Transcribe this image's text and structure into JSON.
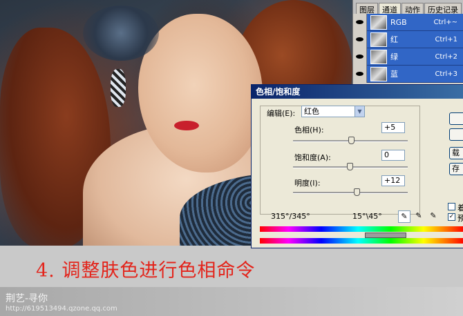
{
  "panel": {
    "tabs": [
      "图层",
      "通道",
      "动作",
      "历史记录"
    ],
    "active_tab": 1,
    "channels": [
      {
        "name": "RGB",
        "shortcut": "Ctrl+~"
      },
      {
        "name": "红",
        "shortcut": "Ctrl+1"
      },
      {
        "name": "绿",
        "shortcut": "Ctrl+2"
      },
      {
        "name": "蓝",
        "shortcut": "Ctrl+3"
      }
    ],
    "row_color": "#3166c6"
  },
  "dialog": {
    "title": "色相/饱和度",
    "edit_label": "编辑(E):",
    "edit_value": "红色",
    "hue_label": "色相(H):",
    "hue_value": "+5",
    "hue_level": 0.51,
    "saturation_label": "饱和度(A):",
    "saturation_value": "0",
    "saturation_level": 0.5,
    "lightness_label": "明度(I):",
    "lightness_value": "+12",
    "lightness_level": 0.56,
    "range_left": "315°/345°",
    "range_right": "15°\\45°",
    "side_buttons": [
      "",
      "",
      "载",
      "存"
    ],
    "colorize_label": "着",
    "colorize_checked": false,
    "preview_label": "预",
    "preview_checked": true,
    "title_color": "#0a246a"
  },
  "annotation": {
    "caption": "4. 调整肤色进行色相命令",
    "caption_color": "#e3241b",
    "watermark_name": "荆艺-寻你",
    "watermark_url": "http://619513494.qzone.qq.com"
  }
}
